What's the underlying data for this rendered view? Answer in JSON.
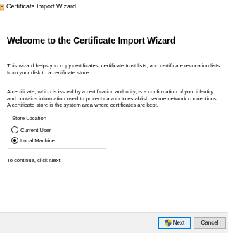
{
  "window": {
    "title": "Certificate Import Wizard",
    "title_icon": "certificate-wizard-icon"
  },
  "page": {
    "heading": "Welcome to the Certificate Import Wizard",
    "intro": "This wizard helps you copy certificates, certificate trust lists, and certificate revocation lists from your disk to a certificate store.",
    "description": "A certificate, which is issued by a certification authority, is a confirmation of your identity and contains information used to protect data or to establish secure network connections. A certificate store is the system area where certificates are kept.",
    "store_location": {
      "legend": "Store Location",
      "options": [
        {
          "label": "Current User",
          "selected": false
        },
        {
          "label": "Local Machine",
          "selected": true
        }
      ]
    },
    "continue_text": "To continue, click Next."
  },
  "footer": {
    "next_label": "Next",
    "next_icon": "uac-shield-icon",
    "cancel_label": "Cancel"
  },
  "colors": {
    "accent_border": "#0078d7",
    "next_bg": "#e5f1fb",
    "footer_bg": "#f0f0f0"
  }
}
